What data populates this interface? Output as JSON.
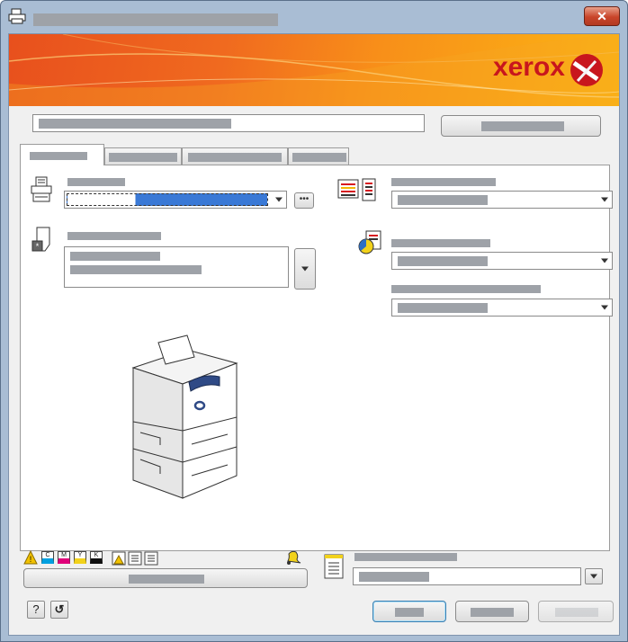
{
  "window": {
    "title": "",
    "close_glyph": "✕"
  },
  "banner": {
    "brand": "xerox"
  },
  "icons": {
    "app": "printer-icon",
    "printer": "printer-stack-icon",
    "document": "document-icon",
    "color_bars": "color-lines-icon",
    "color_mode": "color-wheel-icon",
    "warning": "warning-icon",
    "bell": "bell-icon",
    "list": "list-icon",
    "help": "help-icon",
    "reset": "reset-icon"
  },
  "colors": {
    "banner_start": "#e8501d",
    "banner_end": "#fbb514",
    "brand_red": "#c8161d",
    "selection": "#3a79d6"
  },
  "footer": {
    "help_glyph": "?",
    "reset_glyph": "↺"
  },
  "toner": {
    "c": "C",
    "m": "M",
    "y": "Y",
    "k": "K"
  }
}
